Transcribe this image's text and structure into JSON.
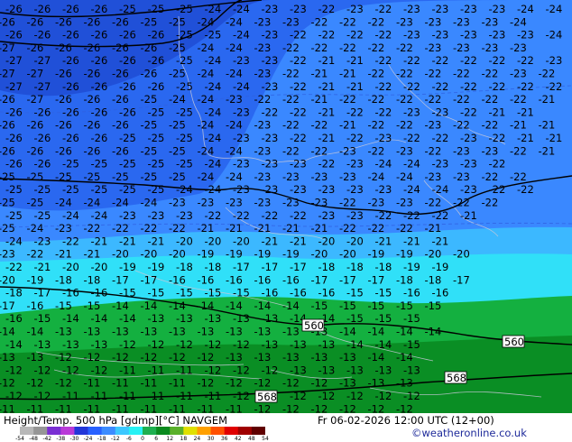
{
  "footer": {
    "title": "Height/Temp. 500 hPa [gdmp][°C] NAVGEM",
    "valid": "Fr 06-02-2026 12:00 UTC (12+00)",
    "credit": "©weatheronline.co.uk"
  },
  "scale": {
    "ticks": [
      "-54",
      "-48",
      "-42",
      "-38",
      "-30",
      "-24",
      "-18",
      "-12",
      "-6",
      "0",
      "6",
      "12",
      "18",
      "24",
      "30",
      "36",
      "42",
      "48",
      "54"
    ],
    "colors": [
      "#b8b8b8",
      "#969696",
      "#7a2fd3",
      "#b93ad8",
      "#2236d8",
      "#2860ff",
      "#3c8cff",
      "#3cc8ff",
      "#27f1f4",
      "#1eb050",
      "#0a8a1e",
      "#5ab02a",
      "#e0e000",
      "#ffa000",
      "#ff5000",
      "#e00000",
      "#a00000",
      "#600000"
    ]
  },
  "map": {
    "height_labels": [
      {
        "text": "560"
      },
      {
        "text": "560"
      },
      {
        "text": "568"
      },
      {
        "text": "568"
      }
    ],
    "temps": [
      [
        "-26",
        "-26",
        "-26",
        "-26",
        "-25",
        "-25",
        "-25",
        "-24",
        "-24",
        "-23",
        "-23",
        "-22",
        "-23",
        "-22",
        "-23",
        "-23",
        "-23",
        "-23",
        "-24",
        "-24"
      ],
      [
        "-26",
        "-26",
        "-26",
        "-26",
        "-26",
        "-25",
        "-25",
        "-24",
        "-24",
        "-23",
        "-23",
        "-22",
        "-22",
        "-22",
        "-23",
        "-23",
        "-23",
        "-23",
        "-24"
      ],
      [
        "-26",
        "-26",
        "-26",
        "-26",
        "-26",
        "-26",
        "-25",
        "-25",
        "-24",
        "-23",
        "-22",
        "-22",
        "-22",
        "-22",
        "-23",
        "-23",
        "-23",
        "-23",
        "-23",
        "-24"
      ],
      [
        "-27",
        "-26",
        "-26",
        "-26",
        "-26",
        "-26",
        "-25",
        "-24",
        "-24",
        "-23",
        "-22",
        "-22",
        "-22",
        "-22",
        "-22",
        "-23",
        "-23",
        "-23",
        "-23"
      ],
      [
        "-27",
        "-27",
        "-26",
        "-26",
        "-26",
        "-26",
        "-25",
        "-24",
        "-23",
        "-23",
        "-22",
        "-21",
        "-21",
        "-22",
        "-22",
        "-22",
        "-22",
        "-22",
        "-22",
        "-23",
        "-23"
      ],
      [
        "-27",
        "-27",
        "-26",
        "-26",
        "-26",
        "-26",
        "-25",
        "-24",
        "-24",
        "-23",
        "-22",
        "-21",
        "-21",
        "-22",
        "-22",
        "-22",
        "-22",
        "-22",
        "-23",
        "-22"
      ],
      [
        "-27",
        "-27",
        "-26",
        "-26",
        "-26",
        "-26",
        "-25",
        "-24",
        "-24",
        "-23",
        "-22",
        "-21",
        "-21",
        "-22",
        "-22",
        "-22",
        "-22",
        "-22",
        "-22",
        "-22",
        "-22"
      ],
      [
        "-26",
        "-27",
        "-26",
        "-26",
        "-26",
        "-25",
        "-24",
        "-24",
        "-23",
        "-22",
        "-22",
        "-21",
        "-22",
        "-22",
        "-22",
        "-22",
        "-22",
        "-22",
        "-22",
        "-21"
      ],
      [
        "-26",
        "-26",
        "-26",
        "-26",
        "-26",
        "-25",
        "-25",
        "-24",
        "-23",
        "-22",
        "-22",
        "-21",
        "-22",
        "-22",
        "-23",
        "-23",
        "-22",
        "-21",
        "-21"
      ],
      [
        "-26",
        "-26",
        "-26",
        "-26",
        "-26",
        "-25",
        "-25",
        "-24",
        "-24",
        "-23",
        "-22",
        "-22",
        "-21",
        "-22",
        "-22",
        "-23",
        "-22",
        "-22",
        "-21",
        "-21"
      ],
      [
        "-26",
        "-26",
        "-26",
        "-26",
        "-25",
        "-25",
        "-25",
        "-24",
        "-23",
        "-23",
        "-22",
        "-21",
        "-22",
        "-23",
        "-22",
        "-22",
        "-23",
        "-22",
        "-21",
        "-21"
      ],
      [
        "-26",
        "-26",
        "-26",
        "-26",
        "-26",
        "-25",
        "-25",
        "-24",
        "-24",
        "-23",
        "-22",
        "-22",
        "-23",
        "-22",
        "-23",
        "-22",
        "-23",
        "-23",
        "-22",
        "-21"
      ],
      [
        "-26",
        "-26",
        "-25",
        "-25",
        "-25",
        "-25",
        "-25",
        "-24",
        "-23",
        "-23",
        "-23",
        "-22",
        "-23",
        "-24",
        "-24",
        "-23",
        "-23",
        "-22"
      ],
      [
        "-25",
        "-25",
        "-25",
        "-25",
        "-25",
        "-25",
        "-25",
        "-24",
        "-24",
        "-23",
        "-23",
        "-23",
        "-23",
        "-24",
        "-24",
        "-23",
        "-23",
        "-22",
        "-22"
      ],
      [
        "-25",
        "-25",
        "-25",
        "-25",
        "-25",
        "-25",
        "-24",
        "-24",
        "-23",
        "-23",
        "-23",
        "-23",
        "-23",
        "-23",
        "-24",
        "-24",
        "-23",
        "-22",
        "-22"
      ],
      [
        "-25",
        "-25",
        "-24",
        "-24",
        "-24",
        "-24",
        "-23",
        "-23",
        "-23",
        "-23",
        "-23",
        "-23",
        "-22",
        "-23",
        "-23",
        "-22",
        "-22",
        "-22"
      ],
      [
        "-25",
        "-25",
        "-24",
        "-24",
        "-23",
        "-23",
        "-23",
        "-22",
        "-22",
        "-22",
        "-22",
        "-23",
        "-23",
        "-22",
        "-22",
        "-22",
        "-21"
      ],
      [
        "-25",
        "-24",
        "-23",
        "-22",
        "-22",
        "-22",
        "-22",
        "-21",
        "-21",
        "-21",
        "-21",
        "-21",
        "-22",
        "-22",
        "-22",
        "-21"
      ],
      [
        "-24",
        "-23",
        "-22",
        "-21",
        "-21",
        "-21",
        "-20",
        "-20",
        "-20",
        "-21",
        "-21",
        "-20",
        "-20",
        "-21",
        "-21",
        "-21"
      ],
      [
        "-23",
        "-22",
        "-21",
        "-21",
        "-20",
        "-20",
        "-20",
        "-19",
        "-19",
        "-19",
        "-19",
        "-20",
        "-20",
        "-19",
        "-19",
        "-20",
        "-20"
      ],
      [
        "-22",
        "-21",
        "-20",
        "-20",
        "-19",
        "-19",
        "-18",
        "-18",
        "-17",
        "-17",
        "-17",
        "-18",
        "-18",
        "-18",
        "-19",
        "-19"
      ],
      [
        "-20",
        "-19",
        "-18",
        "-18",
        "-17",
        "-17",
        "-16",
        "-16",
        "-16",
        "-16",
        "-16",
        "-17",
        "-17",
        "-17",
        "-18",
        "-18",
        "-17"
      ],
      [
        "-18",
        "-17",
        "-16",
        "-16",
        "-15",
        "-15",
        "-15",
        "-15",
        "-15",
        "-16",
        "-16",
        "-16",
        "-15",
        "-15",
        "-16",
        "-16"
      ],
      [
        "-17",
        "-16",
        "-15",
        "-15",
        "-14",
        "-14",
        "-14",
        "-14",
        "-14",
        "-14",
        "-14",
        "-15",
        "-15",
        "-15",
        "-15",
        "-15"
      ],
      [
        "-16",
        "-15",
        "-14",
        "-14",
        "-14",
        "-13",
        "-13",
        "-13",
        "-13",
        "-13",
        "-14",
        "-14",
        "-15",
        "-15",
        "-15"
      ],
      [
        "-14",
        "-14",
        "-13",
        "-13",
        "-13",
        "-13",
        "-13",
        "-13",
        "-13",
        "-13",
        "-13",
        "-13",
        "-14",
        "-14",
        "-14",
        "-14"
      ],
      [
        "-14",
        "-13",
        "-13",
        "-13",
        "-12",
        "-12",
        "-12",
        "-12",
        "-12",
        "-13",
        "-13",
        "-13",
        "-14",
        "-14",
        "-15"
      ],
      [
        "-13",
        "-13",
        "-12",
        "-12",
        "-12",
        "-12",
        "-12",
        "-12",
        "-13",
        "-13",
        "-13",
        "-13",
        "-13",
        "-14",
        "-14"
      ],
      [
        "-12",
        "-12",
        "-12",
        "-12",
        "-11",
        "-11",
        "-11",
        "-12",
        "-12",
        "-12",
        "-13",
        "-13",
        "-13",
        "-13",
        "-13"
      ],
      [
        "-12",
        "-12",
        "-12",
        "-11",
        "-11",
        "-11",
        "-11",
        "-12",
        "-12",
        "-12",
        "-12",
        "-12",
        "-13",
        "-13",
        "-13"
      ],
      [
        "-12",
        "-12",
        "-11",
        "-11",
        "-11",
        "-11",
        "-11",
        "-11",
        "-12",
        "-12",
        "-12",
        "-12",
        "-12",
        "-12",
        "-12"
      ],
      [
        "-11",
        "-11",
        "-11",
        "-11",
        "-11",
        "-11",
        "-11",
        "-11",
        "-11",
        "-12",
        "-12",
        "-12",
        "-12",
        "-12",
        "-12"
      ]
    ]
  }
}
